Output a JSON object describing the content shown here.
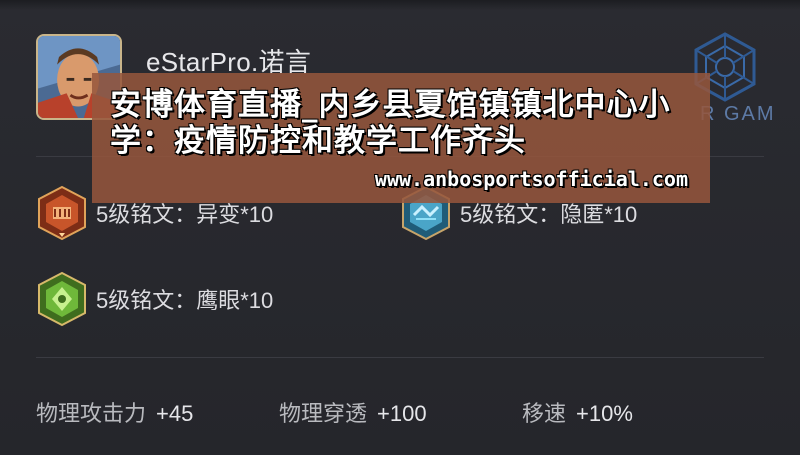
{
  "player": {
    "name": "eStarPro.诺言",
    "team_partial": "R GAM"
  },
  "runes": [
    {
      "label": "5级铭文：异变*10",
      "icon": "rune-yibian-icon",
      "color": "#c8552a"
    },
    {
      "label": "5级铭文：隐匿*10",
      "icon": "rune-yinni-icon",
      "color": "#4aa5c8"
    },
    {
      "label": "5级铭文：鹰眼*10",
      "icon": "rune-yingyan-icon",
      "color": "#6fb83a"
    }
  ],
  "stats": [
    {
      "name": "物理攻击力",
      "value": "+45"
    },
    {
      "name": "物理穿透",
      "value": "+100"
    },
    {
      "name": "移速",
      "value": "+10%"
    }
  ],
  "overlay": {
    "title": "安博体育直播_内乡县夏馆镇镇北中心小学：疫情防控和教学工作齐头",
    "url": "www.anbosportsofficial.com",
    "color": "#96563c"
  }
}
